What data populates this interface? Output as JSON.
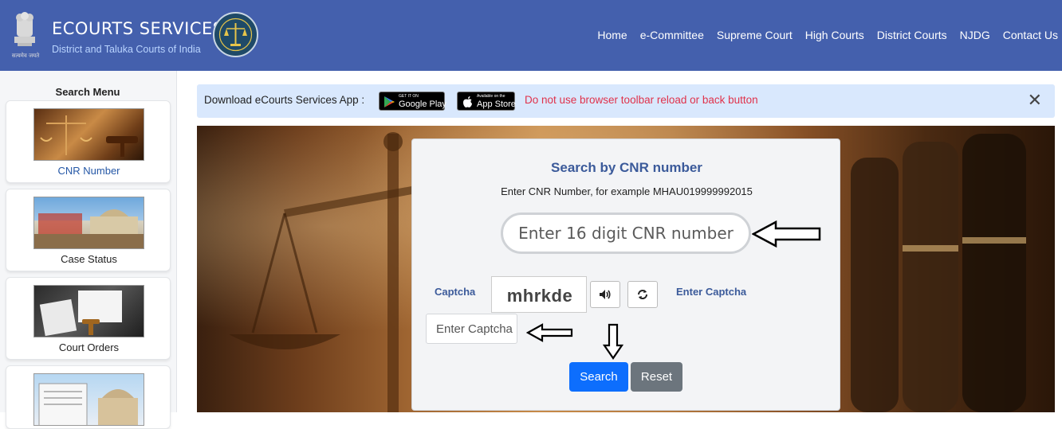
{
  "header": {
    "title": "ECOURTS SERVICES",
    "subtitle": "District and Taluka Courts of India",
    "emblem_caption": "सत्यमेव जयते",
    "nav": [
      "Home",
      "e-Committee",
      "Supreme Court",
      "High Courts",
      "District Courts",
      "NJDG",
      "Contact Us"
    ],
    "bg_color": "#4460ad"
  },
  "sidebar": {
    "title": "Search Menu",
    "items": [
      {
        "label": "CNR Number",
        "icon": "scales-gavel-image",
        "active": true
      },
      {
        "label": "Case Status",
        "icon": "supreme-court-image"
      },
      {
        "label": "Court Orders",
        "icon": "gavel-document-image"
      },
      {
        "label": "",
        "icon": "court-documents-image"
      }
    ]
  },
  "banner": {
    "download_text": "Download eCourts Services App :",
    "google_play_small": "GET IT ON",
    "google_play_big": "Google Play",
    "app_store_small": "Available on the",
    "app_store_big": "App Store",
    "warning": "Do not use browser toolbar reload or back button",
    "close_icon": "close-icon"
  },
  "panel": {
    "title": "Search by CNR number",
    "hint": "Enter CNR Number, for example MHAU019999992015",
    "cnr_placeholder": "Enter 16 digit CNR number",
    "captcha_label": "Captcha",
    "captcha_text": "mhrkde",
    "enter_captcha_label": "Enter Captcha",
    "captcha_placeholder": "Enter Captcha",
    "search_label": "Search",
    "reset_label": "Reset",
    "accent": "#0d6efd"
  }
}
